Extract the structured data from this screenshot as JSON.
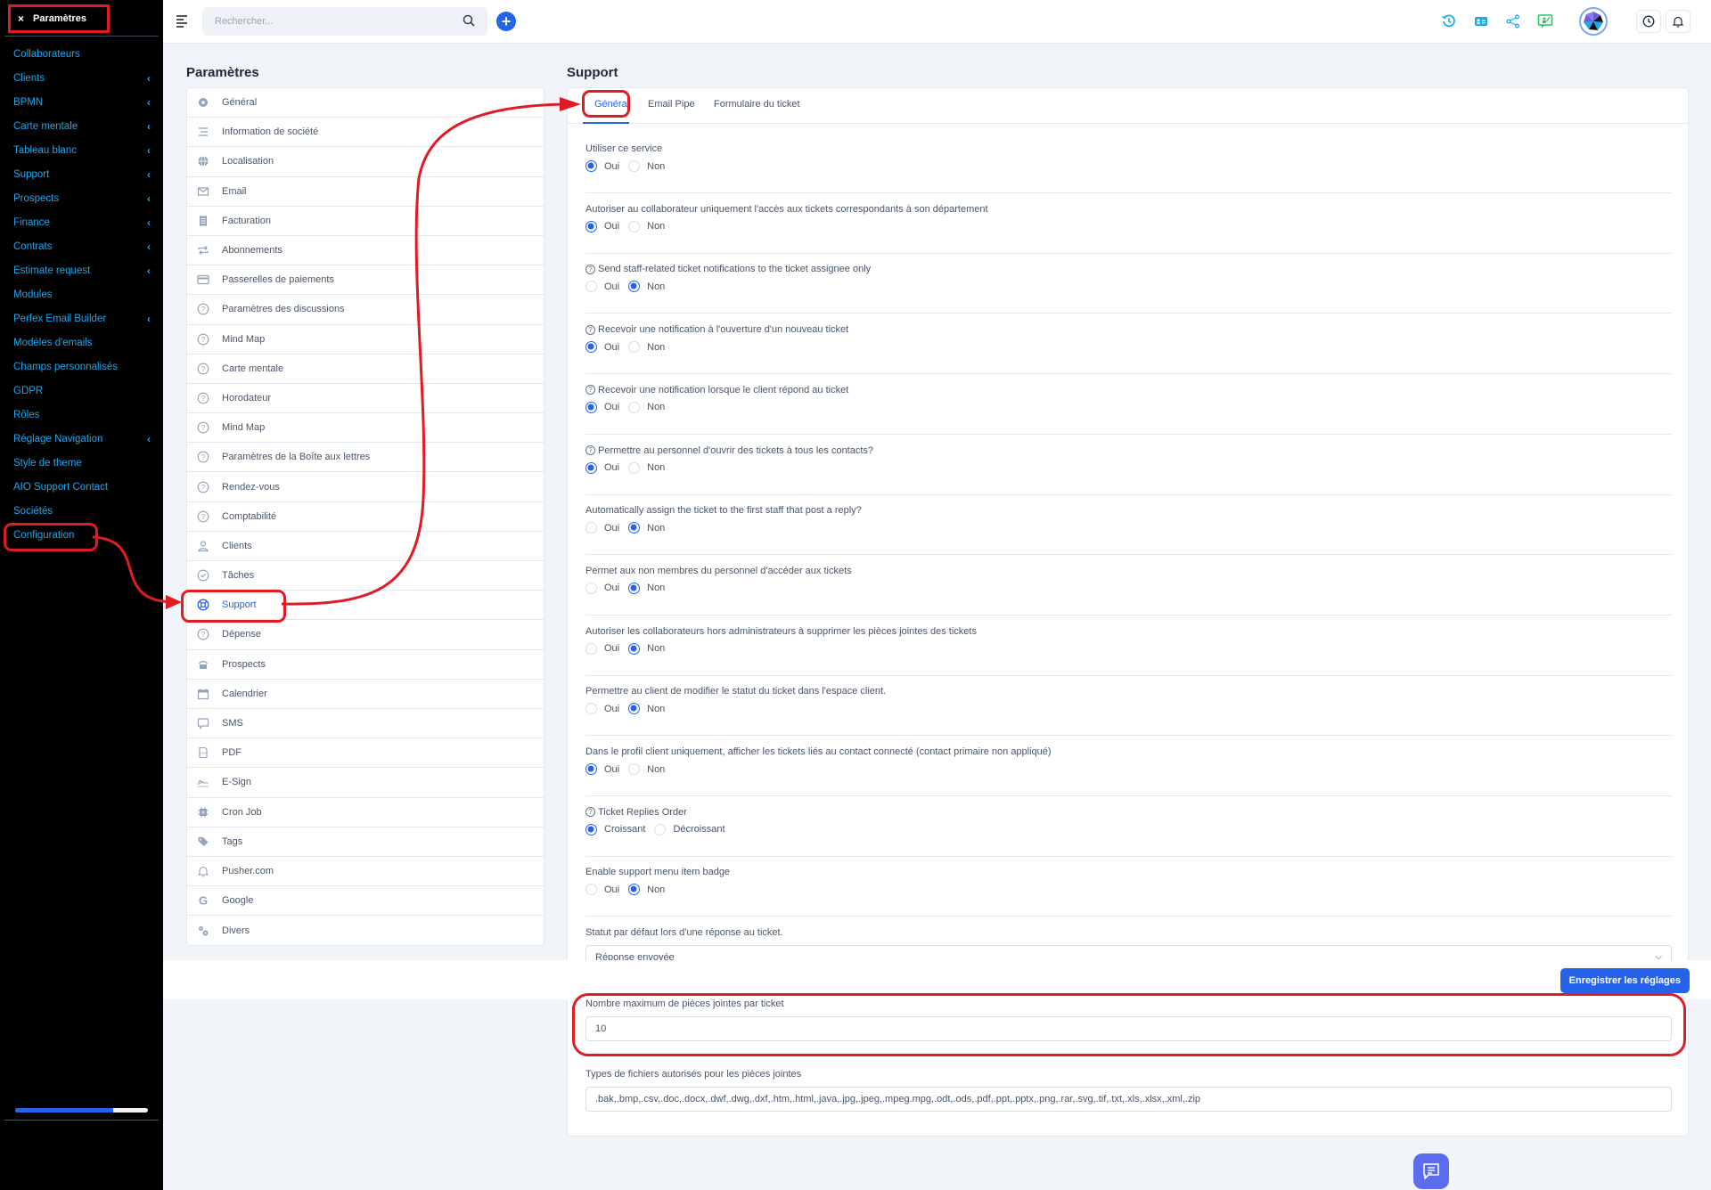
{
  "sidebar": {
    "header": {
      "close_icon": "×",
      "title": "Paramètres"
    },
    "items": [
      {
        "label": "Collaborateurs",
        "chevron": false
      },
      {
        "label": "Clients",
        "chevron": true
      },
      {
        "label": "BPMN",
        "chevron": true
      },
      {
        "label": "Carte mentale",
        "chevron": true
      },
      {
        "label": "Tableau blanc",
        "chevron": true
      },
      {
        "label": "Support",
        "chevron": true
      },
      {
        "label": "Prospects",
        "chevron": true
      },
      {
        "label": "Finance",
        "chevron": true
      },
      {
        "label": "Contrats",
        "chevron": true
      },
      {
        "label": "Estimate request",
        "chevron": true
      },
      {
        "label": "Modules",
        "chevron": false
      },
      {
        "label": "Perfex Email Builder",
        "chevron": true
      },
      {
        "label": "Modèles d'emails",
        "chevron": false
      },
      {
        "label": "Champs personnalisés",
        "chevron": false
      },
      {
        "label": "GDPR",
        "chevron": false
      },
      {
        "label": "Rôles",
        "chevron": false
      },
      {
        "label": "Réglage Navigation",
        "chevron": true
      },
      {
        "label": "Style de theme",
        "chevron": false
      },
      {
        "label": "AIO Support Contact",
        "chevron": false
      },
      {
        "label": "Sociétés",
        "chevron": false
      },
      {
        "label": "Configuration",
        "chevron": false,
        "annotated": true
      }
    ],
    "chevron_glyph": "‹",
    "progress_percent": 74
  },
  "topbar": {
    "search_placeholder": "Rechercher...",
    "add_label": "+",
    "icons": [
      "history-icon",
      "contact-card-icon",
      "share-icon",
      "presentation-chat-icon",
      "avatar",
      "clock-icon",
      "bell-icon"
    ]
  },
  "settings": {
    "title": "Paramètres",
    "items": [
      {
        "label": "Général",
        "icon": "gear"
      },
      {
        "label": "Information de société",
        "icon": "lines"
      },
      {
        "label": "Localisation",
        "icon": "globe"
      },
      {
        "label": "Email",
        "icon": "envelope"
      },
      {
        "label": "Facturation",
        "icon": "receipt"
      },
      {
        "label": "Abonnements",
        "icon": "repeat"
      },
      {
        "label": "Passerelles de paiements",
        "icon": "credit-card"
      },
      {
        "label": "Paramètres des discussions",
        "icon": "question"
      },
      {
        "label": "Mind Map",
        "icon": "question"
      },
      {
        "label": "Carte mentale",
        "icon": "question"
      },
      {
        "label": "Horodateur",
        "icon": "question"
      },
      {
        "label": "Mind Map",
        "icon": "question"
      },
      {
        "label": "Paramètres de la Boîte aux lettres",
        "icon": "question"
      },
      {
        "label": "Rendez-vous",
        "icon": "question"
      },
      {
        "label": "Comptabilité",
        "icon": "question"
      },
      {
        "label": "Clients",
        "icon": "user"
      },
      {
        "label": "Tâches",
        "icon": "check-circle"
      },
      {
        "label": "Support",
        "icon": "lifebuoy",
        "active": true
      },
      {
        "label": "Dépense",
        "icon": "question"
      },
      {
        "label": "Prospects",
        "icon": "phone"
      },
      {
        "label": "Calendrier",
        "icon": "calendar"
      },
      {
        "label": "SMS",
        "icon": "chat"
      },
      {
        "label": "PDF",
        "icon": "pdf"
      },
      {
        "label": "E-Sign",
        "icon": "signature"
      },
      {
        "label": "Cron Job",
        "icon": "chip"
      },
      {
        "label": "Tags",
        "icon": "tag"
      },
      {
        "label": "Pusher.com",
        "icon": "bell"
      },
      {
        "label": "Google",
        "icon": "google"
      },
      {
        "label": "Divers",
        "icon": "gears"
      }
    ]
  },
  "support": {
    "title": "Support",
    "tabs": [
      {
        "label": "Général",
        "active": true
      },
      {
        "label": "Email Pipe",
        "active": false
      },
      {
        "label": "Formulaire du ticket",
        "active": false
      }
    ],
    "options": [
      {
        "label": "Utiliser ce service",
        "help": false,
        "choices": [
          "Oui",
          "Non"
        ],
        "selected": "Oui"
      },
      {
        "label": "Autoriser au collaborateur uniquement l'accès aux tickets correspondants à son département",
        "help": false,
        "choices": [
          "Oui",
          "Non"
        ],
        "selected": "Oui"
      },
      {
        "label": "Send staff-related ticket notifications to the ticket assignee only",
        "help": true,
        "choices": [
          "Oui",
          "Non"
        ],
        "selected": "Non"
      },
      {
        "label": "Recevoir une notification à l'ouverture d'un nouveau ticket",
        "help": true,
        "choices": [
          "Oui",
          "Non"
        ],
        "selected": "Oui"
      },
      {
        "label": "Recevoir une notification lorsque le client répond au ticket",
        "help": true,
        "choices": [
          "Oui",
          "Non"
        ],
        "selected": "Oui"
      },
      {
        "label": "Permettre au personnel d'ouvrir des tickets à tous les contacts?",
        "help": true,
        "choices": [
          "Oui",
          "Non"
        ],
        "selected": "Oui"
      },
      {
        "label": "Automatically assign the ticket to the first staff that post a reply?",
        "help": false,
        "choices": [
          "Oui",
          "Non"
        ],
        "selected": "Non"
      },
      {
        "label": "Permet aux non membres du personnel d'accéder aux tickets",
        "help": false,
        "choices": [
          "Oui",
          "Non"
        ],
        "selected": "Non"
      },
      {
        "label": "Autoriser les collaborateurs hors administrateurs à supprimer les pièces jointes des tickets",
        "help": false,
        "choices": [
          "Oui",
          "Non"
        ],
        "selected": "Non"
      },
      {
        "label": "Permettre au client de modifier le statut du ticket dans l'espace client.",
        "help": false,
        "choices": [
          "Oui",
          "Non"
        ],
        "selected": "Non"
      },
      {
        "label": "Dans le profil client uniquement, afficher les tickets liés au contact connecté (contact primaire non appliqué)",
        "help": false,
        "choices": [
          "Oui",
          "Non"
        ],
        "selected": "Oui"
      },
      {
        "label": "Ticket Replies Order",
        "help": true,
        "choices": [
          "Croissant",
          "Décroissant"
        ],
        "selected": "Croissant"
      },
      {
        "label": "Enable support menu item badge",
        "help": false,
        "choices": [
          "Oui",
          "Non"
        ],
        "selected": "Non"
      }
    ],
    "default_status": {
      "label": "Statut par défaut lors d'une réponse au ticket.",
      "value": "Réponse envoyée"
    },
    "max_attachments": {
      "label": "Nombre maximum de pièces jointes par ticket",
      "value": "10"
    },
    "allowed_types": {
      "label": "Types de fichiers autorisés pour les pièces jointes",
      "value": ".bak,.bmp,.csv,.doc,.docx,.dwf,.dwg,.dxf,.htm,.html,.java,.jpg,.jpeg,.mpeg.mpg,.odt,.ods,.pdf,.ppt,.pptx,.png,.rar,.svg,.tif,.txt,.xls,.xlsx,.xml,.zip"
    }
  },
  "footer": {
    "save_label": "Enregistrer les réglages"
  },
  "colors": {
    "accent": "#2563eb",
    "sidebar_bg": "#000000",
    "sidebar_link": "#1ba8f0",
    "annotation": "#e01b24",
    "page_bg": "#f1f4f9"
  }
}
